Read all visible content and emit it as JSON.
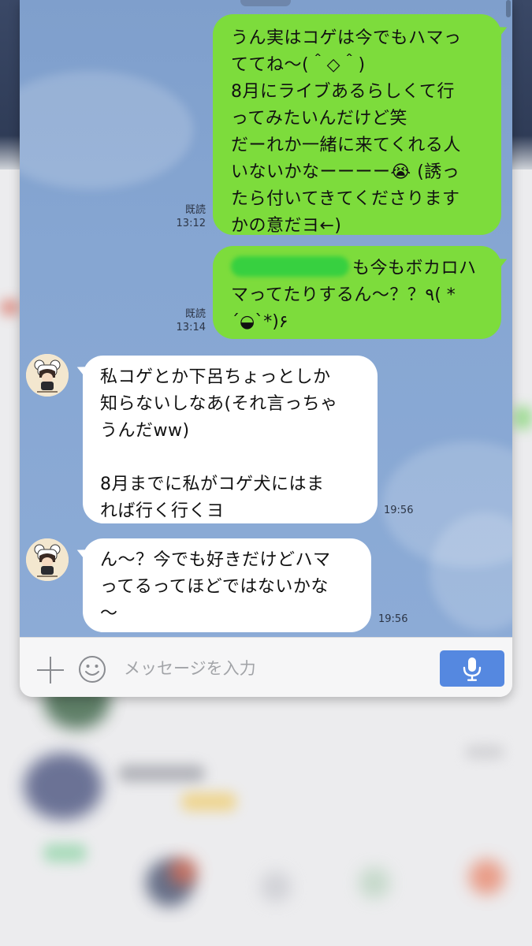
{
  "chat": {
    "messages_out": [
      {
        "lines": [
          "うん実はコゲは今でもハマっ",
          "ててね〜(＾◇＾)",
          "8月にライブあるらしくて行",
          "ってみたいんだけど笑",
          "だーれか一緒に来てくれる人",
          "いないかなーーーー😭 (誘っ",
          "たら付いてきてくださります",
          "かの意だヨ←)"
        ],
        "read_label": "既読",
        "time": "13:12"
      },
      {
        "lines_first_suffix": "も今もボカロハ",
        "lines": [
          "マってたりするん〜？？٩( *",
          "´◒`*)۶"
        ],
        "read_label": "既読",
        "time": "13:14"
      }
    ],
    "messages_in": [
      {
        "lines": [
          "私コゲとか下呂ちょっとしか",
          "知らないしなあ(それ言っちゃ",
          "うんだww)",
          "",
          "8月までに私がコゲ犬にはま",
          "れば行く行くヨ"
        ],
        "time": "19:56"
      },
      {
        "lines": [
          "ん〜？今でも好きだけどハマ",
          "ってるってほどではないかな",
          "〜"
        ],
        "time": "19:56"
      }
    ]
  },
  "input_bar": {
    "placeholder": "メッセージを入力",
    "icons": [
      "plus-icon",
      "smile-icon",
      "microphone-icon"
    ],
    "mic_button_color": "#5588e0"
  },
  "colors": {
    "outgoing_bubble": "#7ddc3c",
    "incoming_bubble": "#ffffff",
    "chat_background": "#86a6d2"
  }
}
